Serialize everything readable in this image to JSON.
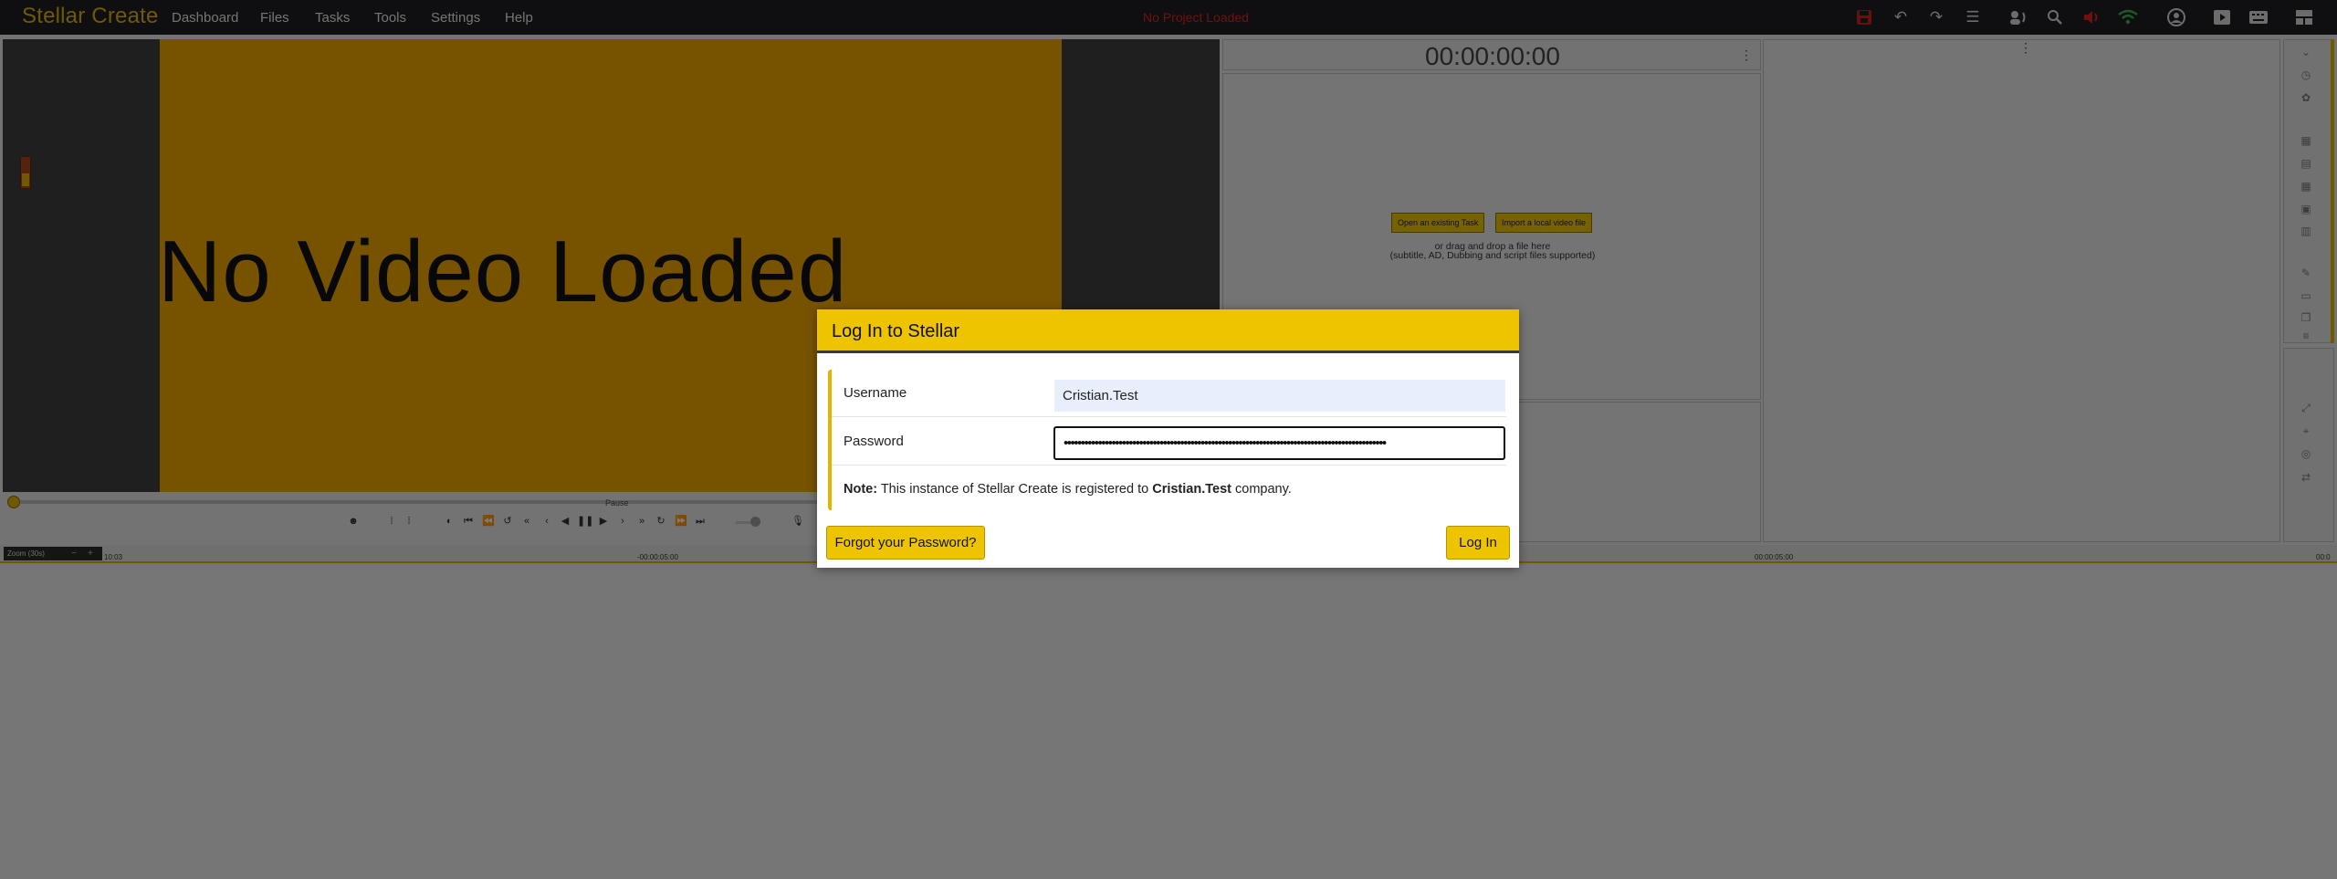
{
  "app": {
    "brand": "Stellar Create",
    "project_status": "No Project Loaded",
    "menu": [
      "Dashboard",
      "Files",
      "Tasks",
      "Tools",
      "Settings",
      "Help"
    ]
  },
  "toolbar_icons": [
    "save-icon",
    "undo-icon",
    "redo-icon",
    "list-icon",
    "speaker-icon",
    "search-icon",
    "audio-icon",
    "wifi-icon",
    "user-icon",
    "play-icon",
    "keyboard-icon",
    "layout-icon"
  ],
  "colors": {
    "accent": "#eec400",
    "status_error": "#e02020",
    "wifi": "#3fb34f"
  },
  "video": {
    "placeholder": "No Video Loaded",
    "transport_state": "Pause"
  },
  "timecode": {
    "value": "00:00:00:00"
  },
  "tasks_panel": {
    "open_task_button": "Open an existing Task",
    "import_button": "Import a local video file",
    "drop_hint_line1": "or drag and drop a file here",
    "drop_hint_line2": "(subtitle, AD, Dubbing and script files supported)"
  },
  "timeline": {
    "zoom_label": "Zoom (30s)",
    "ruler_labels": [
      "10:03",
      "-00:00:05:00",
      "00:00:05:00",
      "00:0"
    ]
  },
  "login": {
    "title": "Log In to Stellar",
    "username_label": "Username",
    "username_value": "Cristian.Test",
    "password_label": "Password",
    "password_value": "••••••••••••••••••••••••••••••••••••••••••••••••••••••••••••••••••••••••••••••••••••••••••••••",
    "note_prefix": "Note:",
    "note_text": " This instance of Stellar Create is registered to ",
    "note_company": "Cristian.Test",
    "note_suffix": " company.",
    "forgot_button": "Forgot your Password?",
    "login_button": "Log In"
  }
}
